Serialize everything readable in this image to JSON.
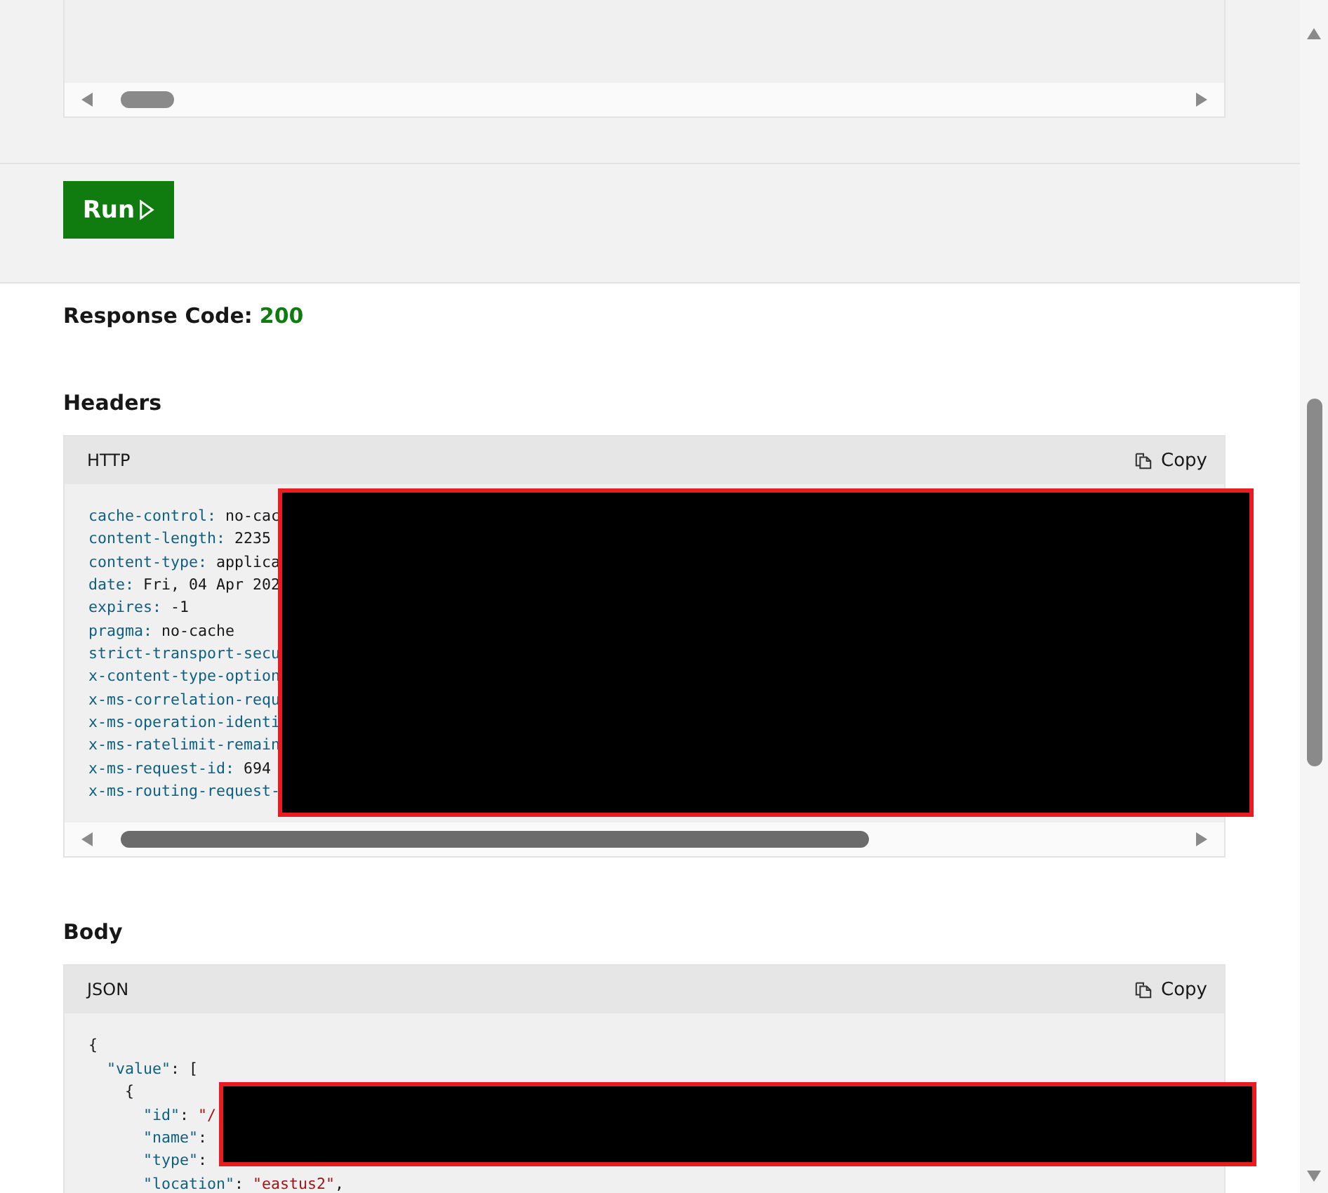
{
  "run_button": {
    "label": "Run"
  },
  "response_code": {
    "label": "Response Code:",
    "value": "200"
  },
  "sections": [
    {
      "heading": "Headers",
      "language": "HTTP",
      "copy_label": "Copy",
      "redacted": true,
      "lines": [
        [
          {
            "kind": "key",
            "text": "cache-control:"
          },
          {
            "kind": "value",
            "text": "no-cac"
          }
        ],
        [
          {
            "kind": "key",
            "text": "content-length:"
          },
          {
            "kind": "value",
            "text": "2235"
          }
        ],
        [
          {
            "kind": "key",
            "text": "content-type:"
          },
          {
            "kind": "value",
            "text": "applica"
          }
        ],
        [
          {
            "kind": "key",
            "text": "date:"
          },
          {
            "kind": "value",
            "text": "Fri, 04 Apr 202"
          }
        ],
        [
          {
            "kind": "key",
            "text": "expires:"
          },
          {
            "kind": "value",
            "text": "-1"
          }
        ],
        [
          {
            "kind": "key",
            "text": "pragma:"
          },
          {
            "kind": "value",
            "text": "no-cache"
          }
        ],
        [
          {
            "kind": "key",
            "text": "strict-transport-secu"
          }
        ],
        [
          {
            "kind": "key",
            "text": "x-content-type-option"
          }
        ],
        [
          {
            "kind": "key",
            "text": "x-ms-correlation-requ"
          }
        ],
        [
          {
            "kind": "key",
            "text": "x-ms-operation-identi"
          }
        ],
        [
          {
            "kind": "key",
            "text": "x-ms-ratelimit-remain"
          }
        ],
        [
          {
            "kind": "key",
            "text": "x-ms-request-id:"
          },
          {
            "kind": "value",
            "text": "694"
          }
        ],
        [
          {
            "kind": "key",
            "text": "x-ms-routing-request-"
          }
        ]
      ]
    },
    {
      "heading": "Body",
      "language": "JSON",
      "copy_label": "Copy",
      "redacted": true,
      "lines": [
        [
          {
            "kind": "punct",
            "text": "{"
          }
        ],
        [
          {
            "kind": "key",
            "text": "  \"value\""
          },
          {
            "kind": "punct",
            "text": ": ["
          }
        ],
        [
          {
            "kind": "punct",
            "text": "    {"
          }
        ],
        [
          {
            "kind": "key",
            "text": "      \"id\""
          },
          {
            "kind": "punct",
            "text": ": "
          },
          {
            "kind": "string",
            "text": "\"/"
          }
        ],
        [
          {
            "kind": "key",
            "text": "      \"name\""
          },
          {
            "kind": "punct",
            "text": ":"
          }
        ],
        [
          {
            "kind": "key",
            "text": "      \"type\""
          },
          {
            "kind": "punct",
            "text": ":"
          }
        ],
        [
          {
            "kind": "key",
            "text": "      \"location\""
          },
          {
            "kind": "punct",
            "text": ": "
          },
          {
            "kind": "string",
            "text": "\"eastus2\""
          },
          {
            "kind": "punct",
            "text": ","
          }
        ]
      ]
    }
  ]
}
